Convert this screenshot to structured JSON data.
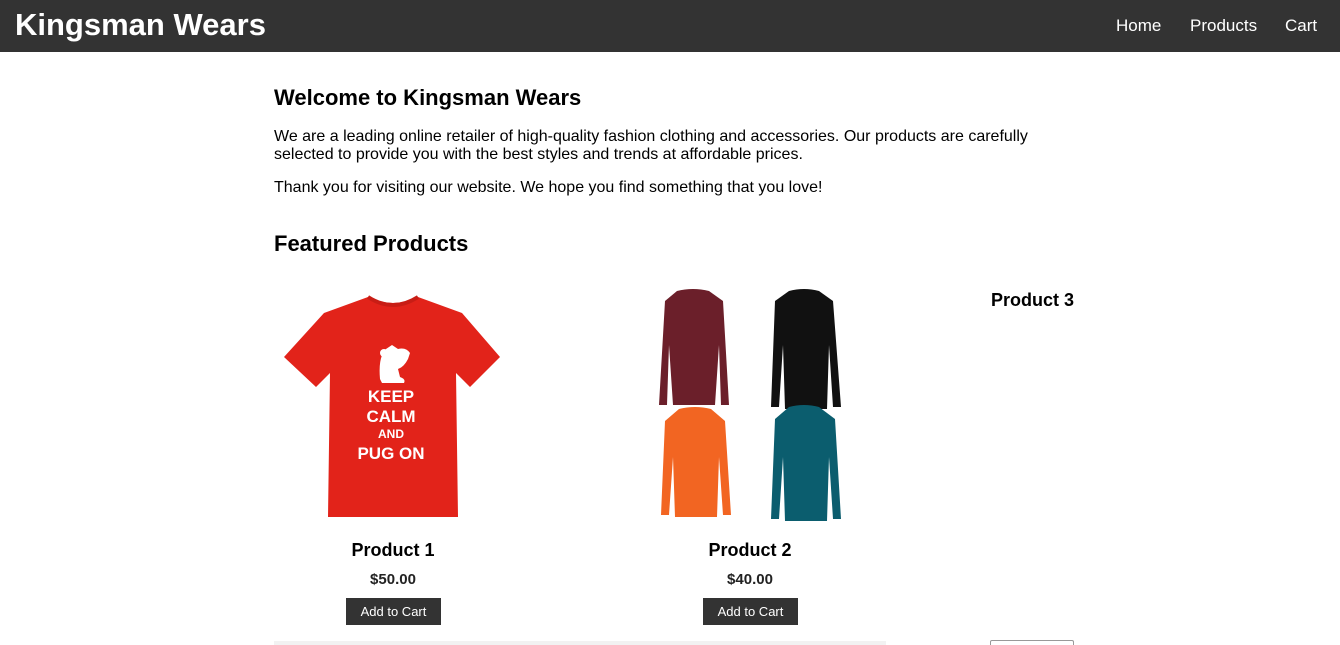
{
  "header": {
    "brand": "Kingsman Wears",
    "nav": [
      {
        "label": "Home"
      },
      {
        "label": "Products"
      },
      {
        "label": "Cart"
      }
    ]
  },
  "welcome": {
    "title": "Welcome to Kingsman Wears",
    "paragraph_1": "We are a leading online retailer of high-quality fashion clothing and accessories. Our products are carefully selected to provide you with the best styles and trends at affordable prices.",
    "paragraph_2": "Thank you for visiting our website. We hope you find something that you love!"
  },
  "featured": {
    "title": "Featured Products",
    "products": [
      {
        "name": "Product 1",
        "price": "$50.00",
        "button": "Add to Cart",
        "image_print": [
          "KEEP",
          "CALM",
          "AND",
          "PUG ON"
        ],
        "image_color": "#e2231a"
      },
      {
        "name": "Product 2",
        "price": "$40.00",
        "button": "Add to Cart",
        "image_colors": [
          "#6b1f2a",
          "#111111",
          "#f26522",
          "#0b5d6e"
        ]
      },
      {
        "name": "Product 3"
      }
    ]
  },
  "colors": {
    "header_bg": "#333333",
    "button_bg": "#333333",
    "page_bg": "#ffffff"
  }
}
